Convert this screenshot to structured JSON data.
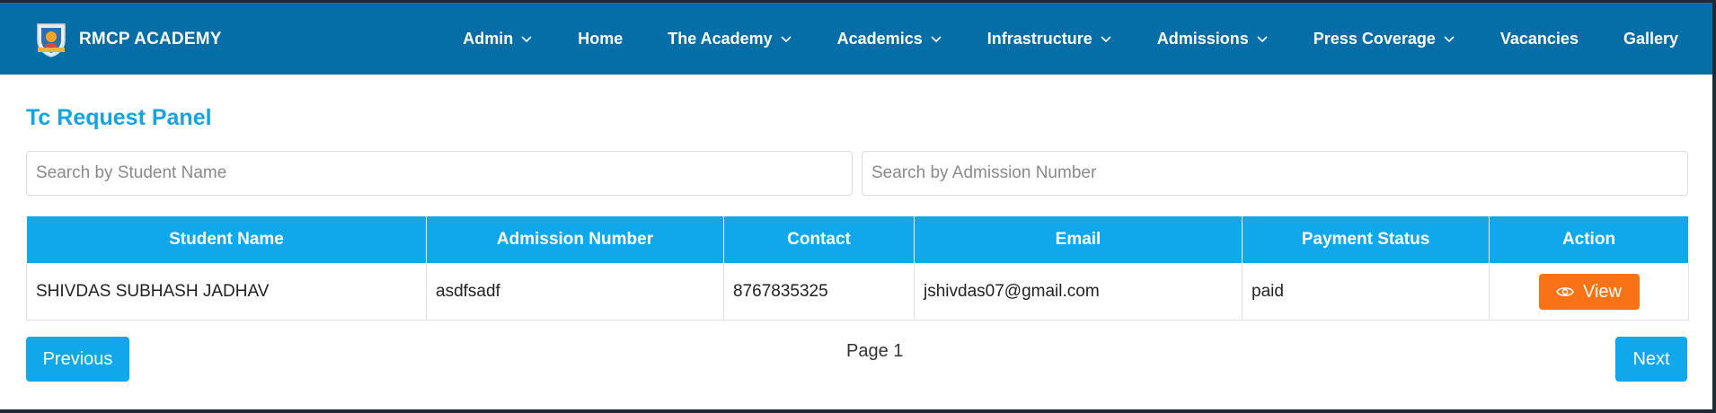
{
  "header": {
    "brand": "RMCP ACADEMY",
    "nav": [
      {
        "label": "Admin",
        "dropdown": true
      },
      {
        "label": "Home",
        "dropdown": false
      },
      {
        "label": "The Academy",
        "dropdown": true
      },
      {
        "label": "Academics",
        "dropdown": true
      },
      {
        "label": "Infrastructure",
        "dropdown": true
      },
      {
        "label": "Admissions",
        "dropdown": true
      },
      {
        "label": "Press Coverage",
        "dropdown": true
      },
      {
        "label": "Vacancies",
        "dropdown": false
      },
      {
        "label": "Gallery",
        "dropdown": false
      }
    ]
  },
  "main": {
    "title": "Tc Request Panel",
    "search_name_placeholder": "Search by Student Name",
    "search_admission_placeholder": "Search by Admission Number",
    "columns": [
      "Student Name",
      "Admission Number",
      "Contact",
      "Email",
      "Payment Status",
      "Action"
    ],
    "rows": [
      {
        "student_name": "SHIVDAS SUBHASH JADHAV",
        "admission_number": "asdfsadf",
        "contact": "8767835325",
        "email": "jshivdas07@gmail.com",
        "payment_status": "paid",
        "action_label": "View"
      }
    ]
  },
  "pagination": {
    "previous_label": "Previous",
    "page_label": "Page 1",
    "next_label": "Next"
  },
  "colors": {
    "navbar": "#066ea6",
    "accent": "#11a8eb",
    "view_button": "#f97316"
  }
}
